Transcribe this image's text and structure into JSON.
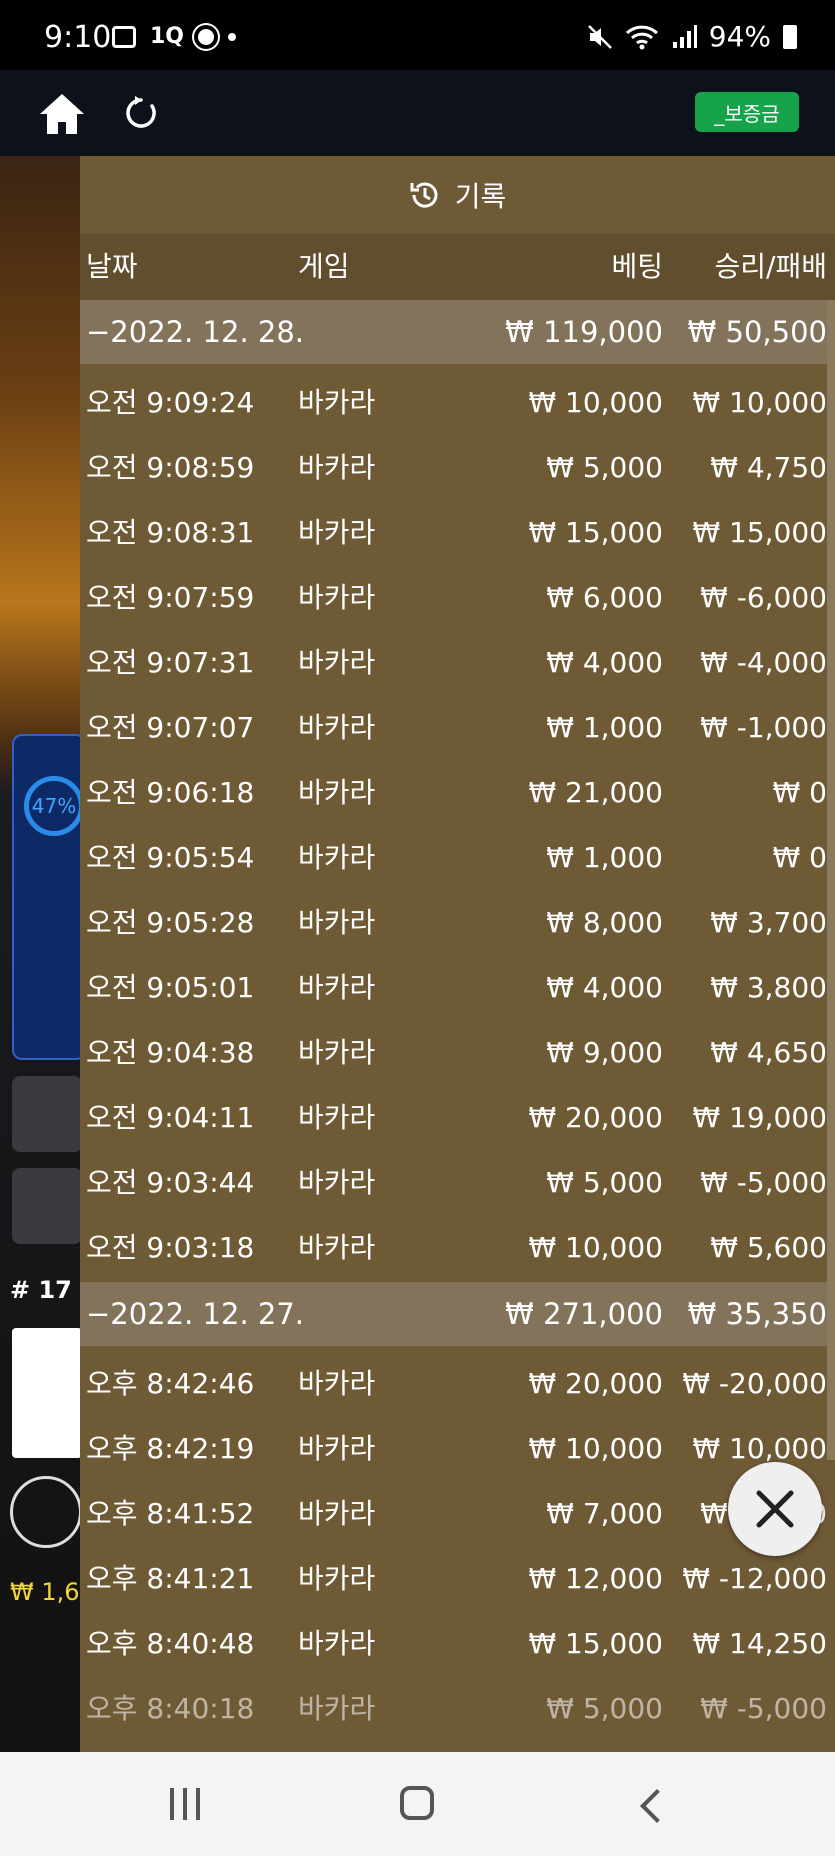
{
  "status_bar": {
    "time": "9:10",
    "notif_text": "1Q",
    "battery": "94%"
  },
  "app_bar": {
    "deposit_label": "_보증금"
  },
  "background": {
    "percent": "47%",
    "round": "# 17",
    "balance_snippet": "₩ 1,6"
  },
  "history": {
    "title": "기록",
    "columns": {
      "date": "날짜",
      "game": "게임",
      "bet": "베팅",
      "result": "승리/패배"
    },
    "groups": [
      {
        "date": "−2022. 12. 28.",
        "bet_total": "₩ 119,000",
        "result_total": "₩ 50,500",
        "rows": [
          {
            "time": "오전 9:09:24",
            "game": "바카라",
            "bet": "₩ 10,000",
            "result": "₩ 10,000"
          },
          {
            "time": "오전 9:08:59",
            "game": "바카라",
            "bet": "₩ 5,000",
            "result": "₩ 4,750"
          },
          {
            "time": "오전 9:08:31",
            "game": "바카라",
            "bet": "₩ 15,000",
            "result": "₩ 15,000"
          },
          {
            "time": "오전 9:07:59",
            "game": "바카라",
            "bet": "₩ 6,000",
            "result": "₩ -6,000"
          },
          {
            "time": "오전 9:07:31",
            "game": "바카라",
            "bet": "₩ 4,000",
            "result": "₩ -4,000"
          },
          {
            "time": "오전 9:07:07",
            "game": "바카라",
            "bet": "₩ 1,000",
            "result": "₩ -1,000"
          },
          {
            "time": "오전 9:06:18",
            "game": "바카라",
            "bet": "₩ 21,000",
            "result": "₩ 0"
          },
          {
            "time": "오전 9:05:54",
            "game": "바카라",
            "bet": "₩ 1,000",
            "result": "₩ 0"
          },
          {
            "time": "오전 9:05:28",
            "game": "바카라",
            "bet": "₩ 8,000",
            "result": "₩ 3,700"
          },
          {
            "time": "오전 9:05:01",
            "game": "바카라",
            "bet": "₩ 4,000",
            "result": "₩ 3,800"
          },
          {
            "time": "오전 9:04:38",
            "game": "바카라",
            "bet": "₩ 9,000",
            "result": "₩ 4,650"
          },
          {
            "time": "오전 9:04:11",
            "game": "바카라",
            "bet": "₩ 20,000",
            "result": "₩ 19,000"
          },
          {
            "time": "오전 9:03:44",
            "game": "바카라",
            "bet": "₩ 5,000",
            "result": "₩ -5,000"
          },
          {
            "time": "오전 9:03:18",
            "game": "바카라",
            "bet": "₩ 10,000",
            "result": "₩ 5,600"
          }
        ]
      },
      {
        "date": "−2022. 12. 27.",
        "bet_total": "₩ 271,000",
        "result_total": "₩ 35,350",
        "rows": [
          {
            "time": "오후 8:42:46",
            "game": "바카라",
            "bet": "₩ 20,000",
            "result": "₩ -20,000"
          },
          {
            "time": "오후 8:42:19",
            "game": "바카라",
            "bet": "₩ 10,000",
            "result": "₩ 10,000"
          },
          {
            "time": "오후 8:41:52",
            "game": "바카라",
            "bet": "₩ 7,000",
            "result": "₩ -7,000"
          },
          {
            "time": "오후 8:41:21",
            "game": "바카라",
            "bet": "₩ 12,000",
            "result": "₩ -12,000"
          },
          {
            "time": "오후 8:40:48",
            "game": "바카라",
            "bet": "₩ 15,000",
            "result": "₩ 14,250"
          },
          {
            "time": "오후 8:40:18",
            "game": "바카라",
            "bet": "₩ 5,000",
            "result": "₩ -5,000"
          }
        ]
      }
    ]
  }
}
